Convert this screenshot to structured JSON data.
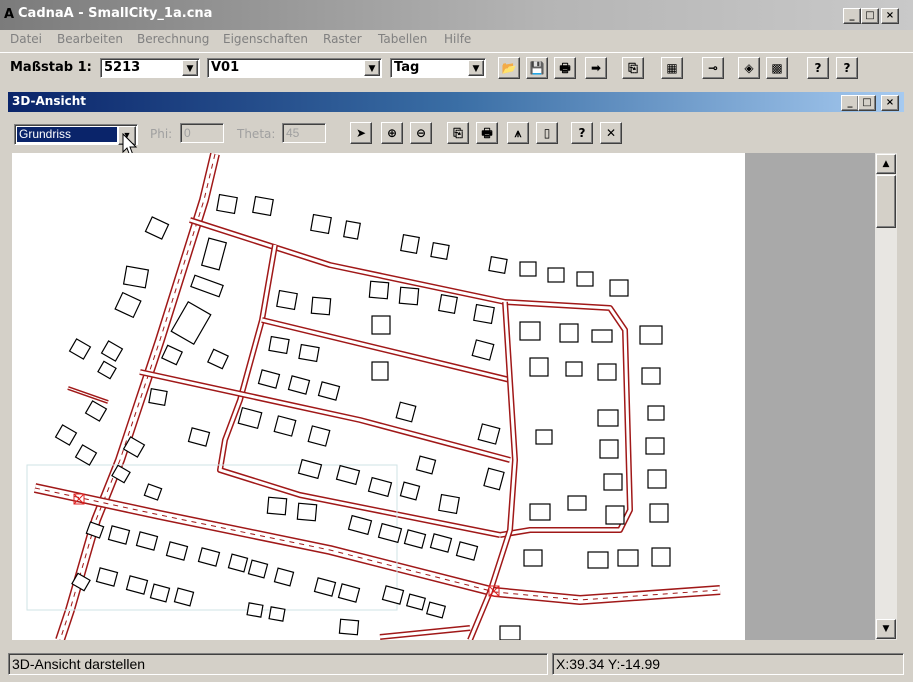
{
  "window": {
    "title": "CadnaA - SmallCity_1a.cna",
    "app_icon_letter": "A",
    "minimize": "_",
    "maximize": "□",
    "close": "×"
  },
  "menu": [
    {
      "label": "Datei"
    },
    {
      "label": "Bearbeiten"
    },
    {
      "label": "Berechnung"
    },
    {
      "label": "Eigenschaften"
    },
    {
      "label": "Raster"
    },
    {
      "label": "Tabellen"
    },
    {
      "label": "Hilfe"
    }
  ],
  "toolbar": {
    "scale_label": "Maßstab 1:",
    "scale_value": "5213",
    "variant_value": "V01",
    "period_value": "Tag",
    "buttons": [
      {
        "name": "open-icon",
        "glyph": "📂"
      },
      {
        "name": "save-icon",
        "glyph": "💾"
      },
      {
        "name": "print-icon",
        "glyph": "🖶"
      },
      {
        "name": "export-arrow-icon",
        "glyph": "➡"
      },
      {
        "name": "copy-icon",
        "glyph": "⎘"
      },
      {
        "name": "calculator-icon",
        "glyph": "▦"
      },
      {
        "name": "pin-icon",
        "glyph": "⊸"
      },
      {
        "name": "object-icon",
        "glyph": "◈"
      },
      {
        "name": "grid-icon",
        "glyph": "▩"
      },
      {
        "name": "context-help-icon",
        "glyph": "?"
      },
      {
        "name": "help-icon",
        "glyph": "?"
      }
    ]
  },
  "child_window": {
    "title": "3D-Ansicht",
    "minimize": "_",
    "maximize": "□",
    "close": "×"
  },
  "view_toolbar": {
    "mode_value": "Grundriss",
    "phi_label": "Phi:",
    "phi_value": "0",
    "theta_label": "Theta:",
    "theta_value": "45",
    "buttons": [
      {
        "name": "select-arrow-icon",
        "glyph": "➤"
      },
      {
        "name": "zoom-in-icon",
        "glyph": "⊕"
      },
      {
        "name": "zoom-out-icon",
        "glyph": "⊖"
      },
      {
        "name": "copy-icon",
        "glyph": "⎘"
      },
      {
        "name": "print-icon",
        "glyph": "🖶"
      },
      {
        "name": "terrain-icon",
        "glyph": "⩚"
      },
      {
        "name": "page-icon",
        "glyph": "▯"
      },
      {
        "name": "help-icon",
        "glyph": "?"
      },
      {
        "name": "close-icon",
        "glyph": "✕"
      }
    ]
  },
  "scrollbar": {
    "up": "▲",
    "down": "▼"
  },
  "colors": {
    "road": "#a01818",
    "building": "#000000",
    "title_active": "#0a246a"
  },
  "status": {
    "message": "3D-Ansicht darstellen",
    "coordinates": "X:39.34 Y:-14.99"
  }
}
